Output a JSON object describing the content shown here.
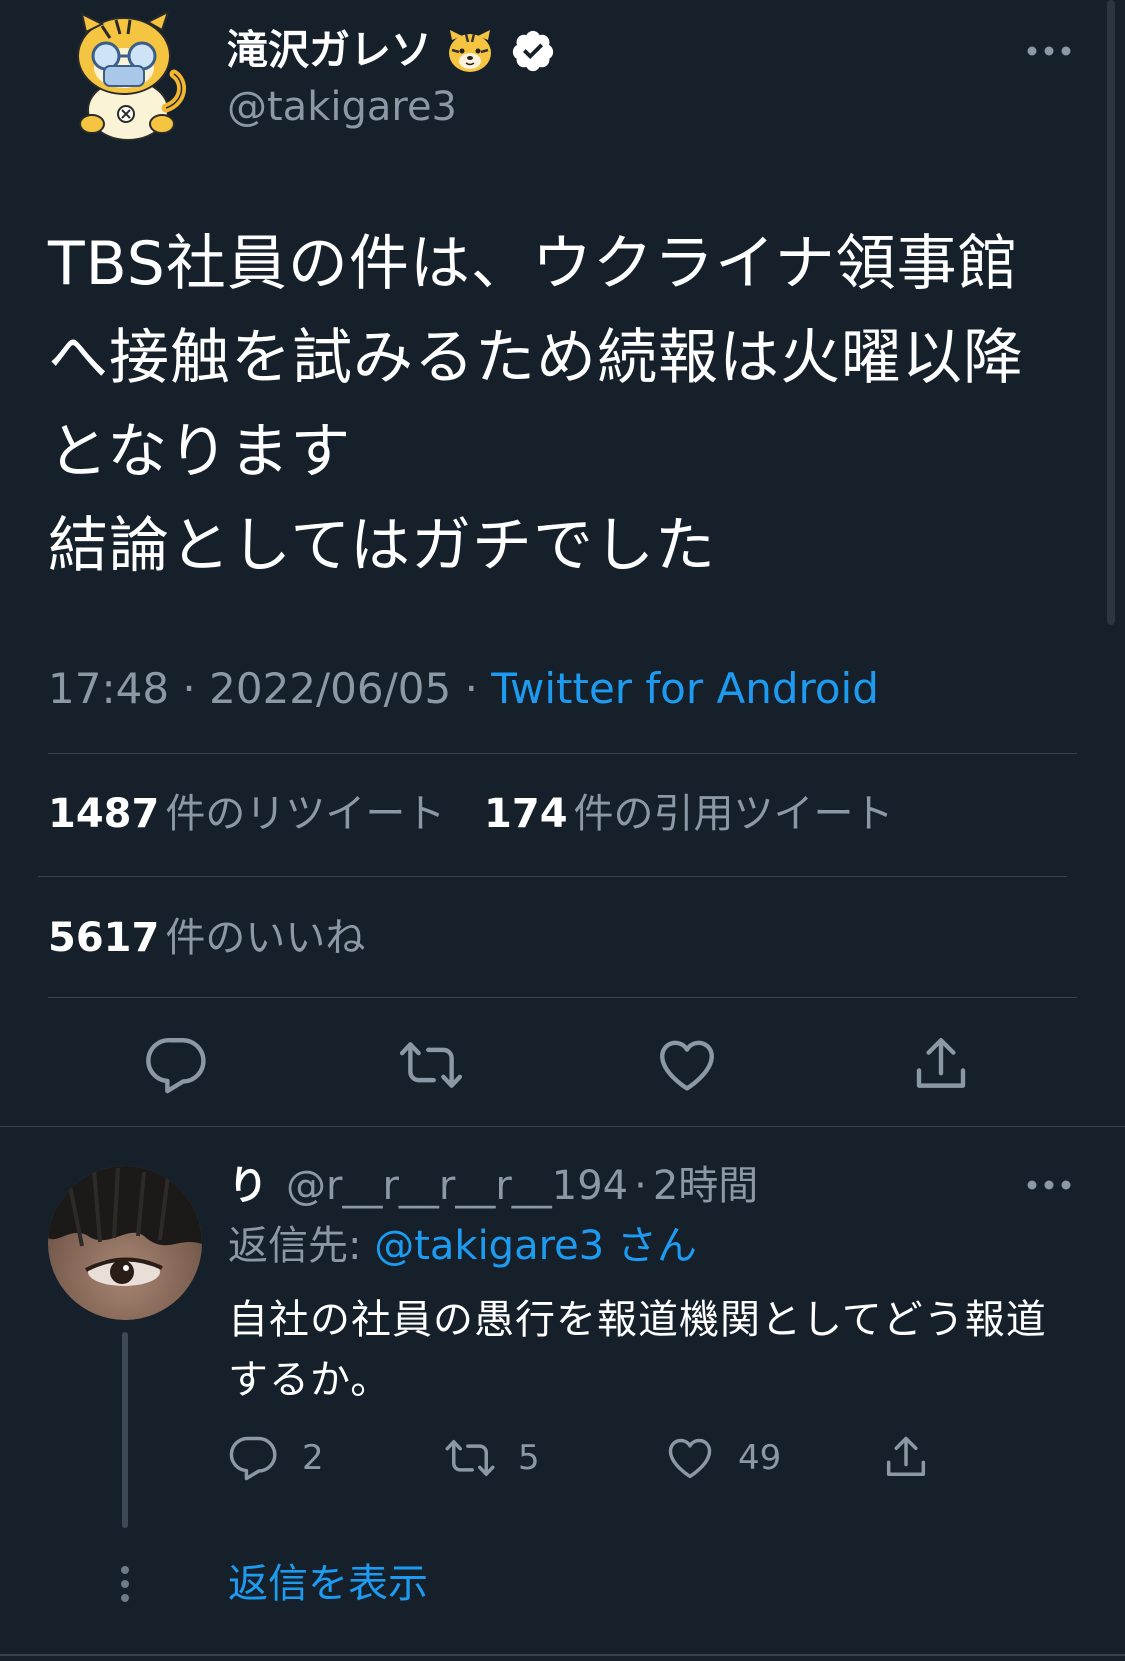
{
  "main_tweet": {
    "author": {
      "display_name": "滝沢ガレソ",
      "handle": "@takigare3",
      "verified": true
    },
    "text": "TBS社員の件は、ウクライナ領事館\nへ接触を試みるため続報は火曜以降\nとなります\n結論としてはガチでした",
    "time": "17:48",
    "separator": "·",
    "date": "2022/06/05",
    "source": "Twitter for Android",
    "stats": {
      "retweets": "1487",
      "retweets_label": "件のリツイート",
      "quotes": "174",
      "quotes_label": "件の引用ツイート",
      "likes": "5617",
      "likes_label": "件のいいね"
    },
    "actions": [
      "reply-icon",
      "retweet-icon",
      "like-icon",
      "share-icon"
    ]
  },
  "reply": {
    "display_name": "り",
    "handle": "@r__r__r__r__194",
    "separator": "·",
    "time": "2時間",
    "replying_prefix": "返信先:",
    "replying_mention": "@takigare3",
    "replying_suffix": "さん",
    "text": "自社の社員の愚行を報道機関としてどう報道\nするか。",
    "counts": {
      "replies": "2",
      "retweets": "5",
      "likes": "49"
    },
    "show_replies": "返信を表示"
  },
  "colors": {
    "background": "#15202b",
    "text": "#ffffff",
    "secondary": "#8b98a5",
    "accent": "#1d9bf0",
    "divider": "#38444d"
  }
}
